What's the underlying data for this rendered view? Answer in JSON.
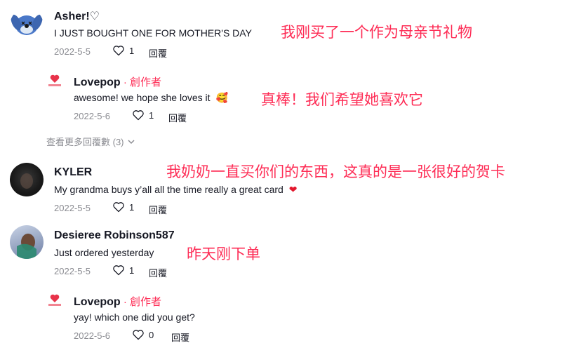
{
  "comments": [
    {
      "user": "Asher!♡",
      "text": "I JUST BOUGHT ONE FOR MOTHER'S DAY",
      "date": "2022-5-5",
      "likes": "1",
      "reply": "回覆",
      "annotation": "我刚买了一个作为母亲节礼物"
    },
    {
      "user": "Lovepop",
      "creator": " · 創作者",
      "text": "awesome! we hope she loves it",
      "emoji": "🥰",
      "date": "2022-5-6",
      "likes": "1",
      "reply": "回覆",
      "annotation": "真棒！我们希望她喜欢它"
    },
    {
      "user": "KYLER",
      "text": "My grandma buys y’all all the time really a great card",
      "emoji": "❤",
      "date": "2022-5-5",
      "likes": "1",
      "reply": "回覆",
      "annotation": "我奶奶一直买你们的东西，这真的是一张很好的贺卡"
    },
    {
      "user": "Desieree Robinson587",
      "text": "Just ordered yesterday",
      "date": "2022-5-5",
      "likes": "1",
      "reply": "回覆",
      "annotation": "昨天刚下单"
    },
    {
      "user": "Lovepop",
      "creator": " · 創作者",
      "text": "yay! which one did you get?",
      "date": "2022-5-6",
      "likes": "0",
      "reply": "回覆"
    }
  ],
  "view_more": "查看更多回覆數 (3)",
  "colors": {
    "accent": "#fe2c55",
    "muted": "#8a8b91",
    "text": "#161823"
  }
}
